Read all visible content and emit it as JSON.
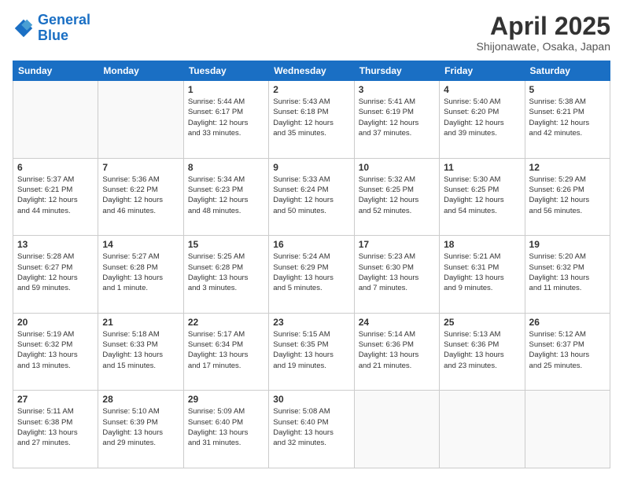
{
  "logo": {
    "line1": "General",
    "line2": "Blue"
  },
  "header": {
    "title": "April 2025",
    "subtitle": "Shijonawate, Osaka, Japan"
  },
  "days_of_week": [
    "Sunday",
    "Monday",
    "Tuesday",
    "Wednesday",
    "Thursday",
    "Friday",
    "Saturday"
  ],
  "weeks": [
    [
      {
        "day": "",
        "info": ""
      },
      {
        "day": "",
        "info": ""
      },
      {
        "day": "1",
        "info": "Sunrise: 5:44 AM\nSunset: 6:17 PM\nDaylight: 12 hours\nand 33 minutes."
      },
      {
        "day": "2",
        "info": "Sunrise: 5:43 AM\nSunset: 6:18 PM\nDaylight: 12 hours\nand 35 minutes."
      },
      {
        "day": "3",
        "info": "Sunrise: 5:41 AM\nSunset: 6:19 PM\nDaylight: 12 hours\nand 37 minutes."
      },
      {
        "day": "4",
        "info": "Sunrise: 5:40 AM\nSunset: 6:20 PM\nDaylight: 12 hours\nand 39 minutes."
      },
      {
        "day": "5",
        "info": "Sunrise: 5:38 AM\nSunset: 6:21 PM\nDaylight: 12 hours\nand 42 minutes."
      }
    ],
    [
      {
        "day": "6",
        "info": "Sunrise: 5:37 AM\nSunset: 6:21 PM\nDaylight: 12 hours\nand 44 minutes."
      },
      {
        "day": "7",
        "info": "Sunrise: 5:36 AM\nSunset: 6:22 PM\nDaylight: 12 hours\nand 46 minutes."
      },
      {
        "day": "8",
        "info": "Sunrise: 5:34 AM\nSunset: 6:23 PM\nDaylight: 12 hours\nand 48 minutes."
      },
      {
        "day": "9",
        "info": "Sunrise: 5:33 AM\nSunset: 6:24 PM\nDaylight: 12 hours\nand 50 minutes."
      },
      {
        "day": "10",
        "info": "Sunrise: 5:32 AM\nSunset: 6:25 PM\nDaylight: 12 hours\nand 52 minutes."
      },
      {
        "day": "11",
        "info": "Sunrise: 5:30 AM\nSunset: 6:25 PM\nDaylight: 12 hours\nand 54 minutes."
      },
      {
        "day": "12",
        "info": "Sunrise: 5:29 AM\nSunset: 6:26 PM\nDaylight: 12 hours\nand 56 minutes."
      }
    ],
    [
      {
        "day": "13",
        "info": "Sunrise: 5:28 AM\nSunset: 6:27 PM\nDaylight: 12 hours\nand 59 minutes."
      },
      {
        "day": "14",
        "info": "Sunrise: 5:27 AM\nSunset: 6:28 PM\nDaylight: 13 hours\nand 1 minute."
      },
      {
        "day": "15",
        "info": "Sunrise: 5:25 AM\nSunset: 6:28 PM\nDaylight: 13 hours\nand 3 minutes."
      },
      {
        "day": "16",
        "info": "Sunrise: 5:24 AM\nSunset: 6:29 PM\nDaylight: 13 hours\nand 5 minutes."
      },
      {
        "day": "17",
        "info": "Sunrise: 5:23 AM\nSunset: 6:30 PM\nDaylight: 13 hours\nand 7 minutes."
      },
      {
        "day": "18",
        "info": "Sunrise: 5:21 AM\nSunset: 6:31 PM\nDaylight: 13 hours\nand 9 minutes."
      },
      {
        "day": "19",
        "info": "Sunrise: 5:20 AM\nSunset: 6:32 PM\nDaylight: 13 hours\nand 11 minutes."
      }
    ],
    [
      {
        "day": "20",
        "info": "Sunrise: 5:19 AM\nSunset: 6:32 PM\nDaylight: 13 hours\nand 13 minutes."
      },
      {
        "day": "21",
        "info": "Sunrise: 5:18 AM\nSunset: 6:33 PM\nDaylight: 13 hours\nand 15 minutes."
      },
      {
        "day": "22",
        "info": "Sunrise: 5:17 AM\nSunset: 6:34 PM\nDaylight: 13 hours\nand 17 minutes."
      },
      {
        "day": "23",
        "info": "Sunrise: 5:15 AM\nSunset: 6:35 PM\nDaylight: 13 hours\nand 19 minutes."
      },
      {
        "day": "24",
        "info": "Sunrise: 5:14 AM\nSunset: 6:36 PM\nDaylight: 13 hours\nand 21 minutes."
      },
      {
        "day": "25",
        "info": "Sunrise: 5:13 AM\nSunset: 6:36 PM\nDaylight: 13 hours\nand 23 minutes."
      },
      {
        "day": "26",
        "info": "Sunrise: 5:12 AM\nSunset: 6:37 PM\nDaylight: 13 hours\nand 25 minutes."
      }
    ],
    [
      {
        "day": "27",
        "info": "Sunrise: 5:11 AM\nSunset: 6:38 PM\nDaylight: 13 hours\nand 27 minutes."
      },
      {
        "day": "28",
        "info": "Sunrise: 5:10 AM\nSunset: 6:39 PM\nDaylight: 13 hours\nand 29 minutes."
      },
      {
        "day": "29",
        "info": "Sunrise: 5:09 AM\nSunset: 6:40 PM\nDaylight: 13 hours\nand 31 minutes."
      },
      {
        "day": "30",
        "info": "Sunrise: 5:08 AM\nSunset: 6:40 PM\nDaylight: 13 hours\nand 32 minutes."
      },
      {
        "day": "",
        "info": ""
      },
      {
        "day": "",
        "info": ""
      },
      {
        "day": "",
        "info": ""
      }
    ]
  ]
}
